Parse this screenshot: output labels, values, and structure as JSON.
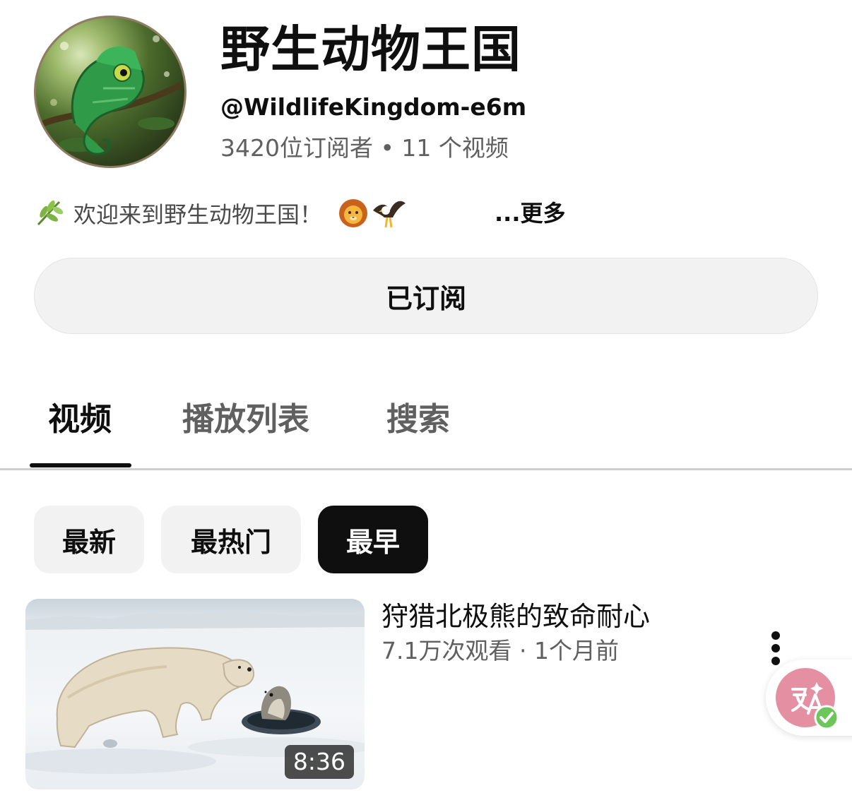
{
  "channel": {
    "name": "野生动物王国",
    "handle": "@WildlifeKingdom-e6m",
    "stats": "3420位订阅者 • 11 个视频",
    "avatar_icon": "chameleon-avatar",
    "description": "欢迎来到野生动物王国！",
    "description_icons": [
      "herb-icon",
      "lion-face-icon",
      "eagle-icon"
    ],
    "more_label": "...更多"
  },
  "subscribe": {
    "label": "已订阅"
  },
  "tabs": [
    {
      "label": "视频",
      "active": true
    },
    {
      "label": "播放列表",
      "active": false
    },
    {
      "label": "搜索",
      "active": false
    }
  ],
  "sort_chips": [
    {
      "label": "最新",
      "selected": false
    },
    {
      "label": "最热门",
      "selected": false
    },
    {
      "label": "最早",
      "selected": true
    }
  ],
  "videos": [
    {
      "title": "狩猎北极熊的致命耐心",
      "meta": "7.1万次观看 · 1个月前",
      "duration": "8:36",
      "thumbnail": "polar-bear-seal-thumbnail"
    }
  ],
  "floating_widget": {
    "icon": "translate-icon",
    "status_icon": "check-badge-icon"
  },
  "colors": {
    "text_primary": "#0f0f0f",
    "text_secondary": "#606060",
    "chip_bg": "#f2f2f2",
    "chip_selected_bg": "#0f0f0f",
    "widget_pink": "#e58fa3",
    "check_green": "#6dc65a"
  }
}
